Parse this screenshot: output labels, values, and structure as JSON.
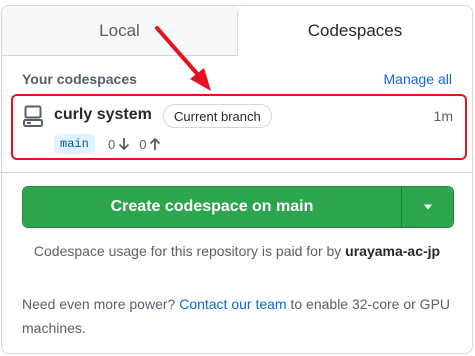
{
  "tabs": [
    {
      "label": "Local",
      "active": false
    },
    {
      "label": "Codespaces",
      "active": true
    }
  ],
  "section": {
    "title": "Your codespaces",
    "manage_label": "Manage all"
  },
  "codespace": {
    "icon": "codespace-icon",
    "name": "curly system",
    "branch_status": "Current branch",
    "time": "1m",
    "branch": "main",
    "behind": "0",
    "ahead": "0"
  },
  "create": {
    "label": "Create codespace on main",
    "dropdown_icon": "triangle-down-icon"
  },
  "usage": {
    "prefix": "Codespace usage for this repository is paid for by ",
    "owner": "urayama-ac-jp"
  },
  "power": {
    "prefix": "Need even more power? ",
    "link": "Contact our team",
    "suffix": " to enable 32-core or GPU machines."
  },
  "colors": {
    "accent": "#2da44e",
    "link": "#0969da",
    "annotation": "#e5121f",
    "badge_bg": "#ddf4ff"
  }
}
